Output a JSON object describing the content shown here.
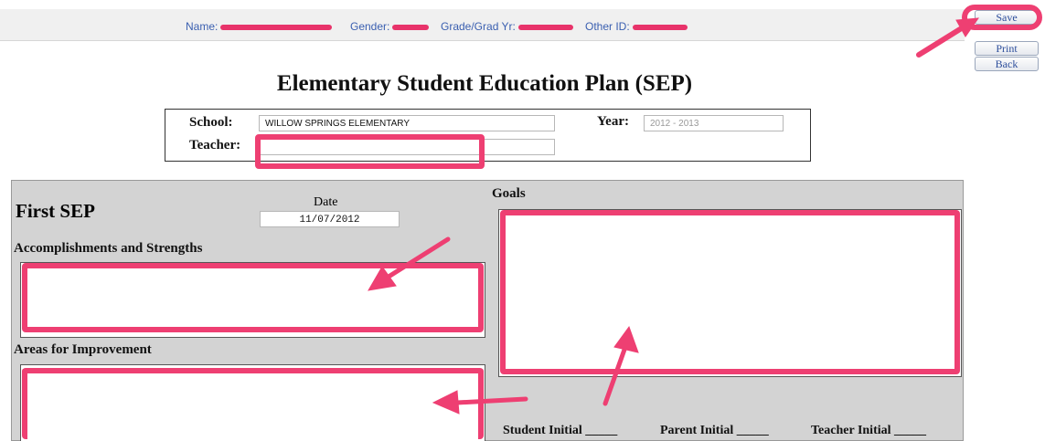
{
  "header": {
    "name_label": "Name:",
    "gender_label": "Gender:",
    "grade_label": "Grade/Grad Yr:",
    "other_id_label": "Other ID:"
  },
  "nav": {
    "save": "Save",
    "print": "Print",
    "back": "Back"
  },
  "title": "Elementary Student Education Plan (SEP)",
  "school_info": {
    "school_label": "School:",
    "school_value": "WILLOW SPRINGS ELEMENTARY",
    "year_label": "Year:",
    "year_value": "2012 - 2013",
    "teacher_label": "Teacher:",
    "teacher_value": ""
  },
  "sep": {
    "section_title": "First SEP",
    "date_label": "Date",
    "date_value": "11/07/2012",
    "accomplishments_label": "Accomplishments and Strengths",
    "accomplishments_value": "",
    "improvement_label": "Areas for Improvement",
    "improvement_value": "",
    "goals_label": "Goals",
    "goals_value": "",
    "student_initial": "Student Initial _____",
    "parent_initial": "Parent Initial _____",
    "teacher_initial": "Teacher Initial _____"
  },
  "colors": {
    "highlight": "#ee3f72",
    "link": "#3a5fb0",
    "panel": "#d3d3d3"
  }
}
